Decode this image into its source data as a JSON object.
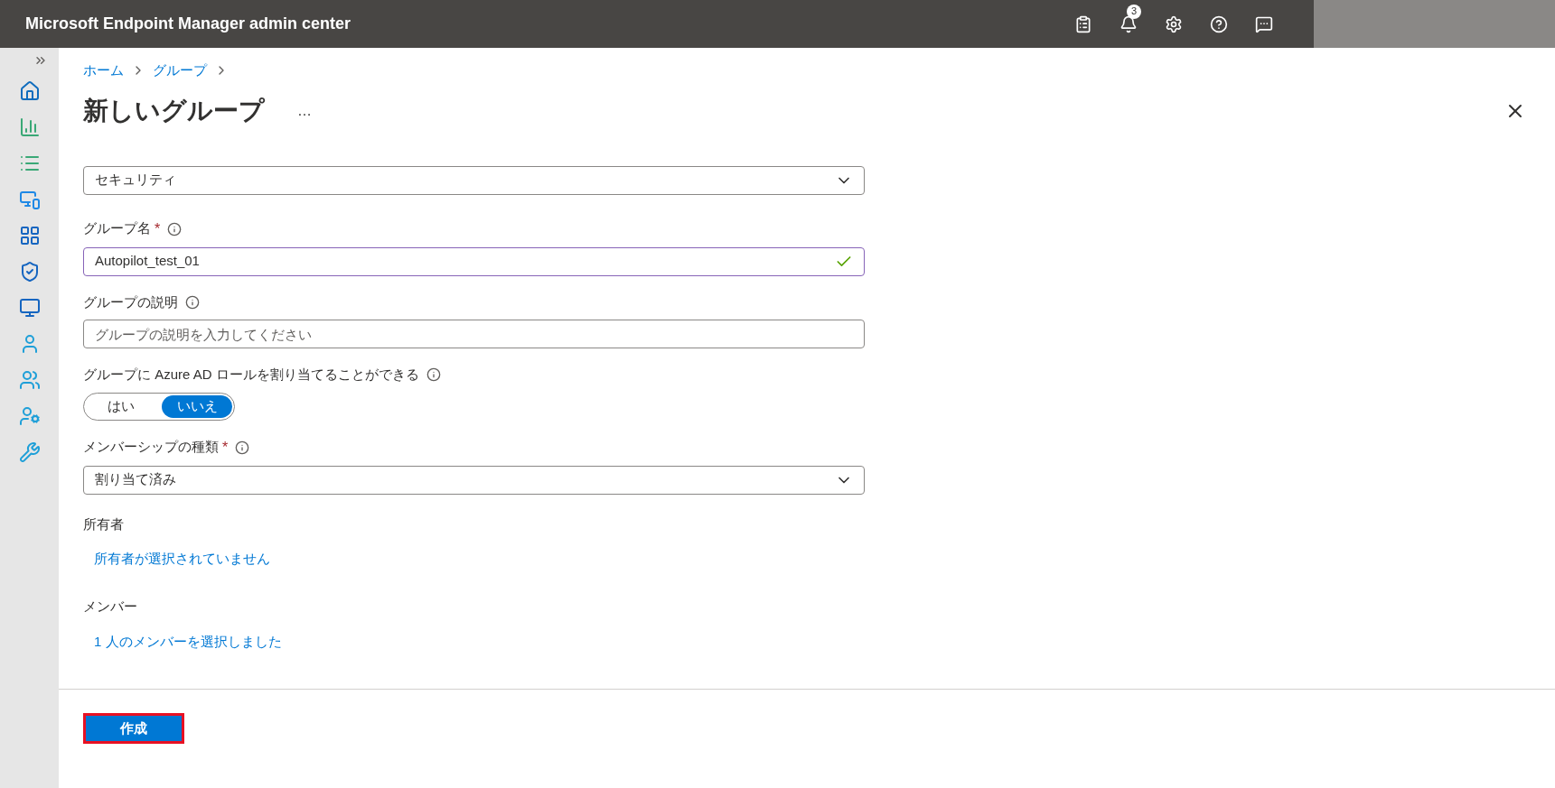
{
  "header": {
    "title": "Microsoft Endpoint Manager admin center",
    "notification_count": "3"
  },
  "breadcrumb": [
    "ホーム",
    "グループ"
  ],
  "page": {
    "title": "新しいグループ",
    "more": "…"
  },
  "form": {
    "group_type": {
      "value": "セキュリティ"
    },
    "group_name": {
      "label": "グループ名",
      "required_mark": "*",
      "value": "Autopilot_test_01",
      "valid": true
    },
    "description": {
      "label": "グループの説明",
      "placeholder": "グループの説明を入力してください"
    },
    "azure_ad_roles": {
      "label": "グループに Azure AD ロールを割り当てることができる",
      "options": [
        {
          "label": "はい",
          "selected": false
        },
        {
          "label": "いいえ",
          "selected": true
        }
      ]
    },
    "membership_type": {
      "label": "メンバーシップの種類",
      "required_mark": "*",
      "value": "割り当て済み"
    },
    "owners": {
      "label": "所有者",
      "link": "所有者が選択されていません"
    },
    "members": {
      "label": "メンバー",
      "link": "1 人のメンバーを選択しました"
    }
  },
  "footer": {
    "create_button": "作成",
    "highlighted": true
  }
}
